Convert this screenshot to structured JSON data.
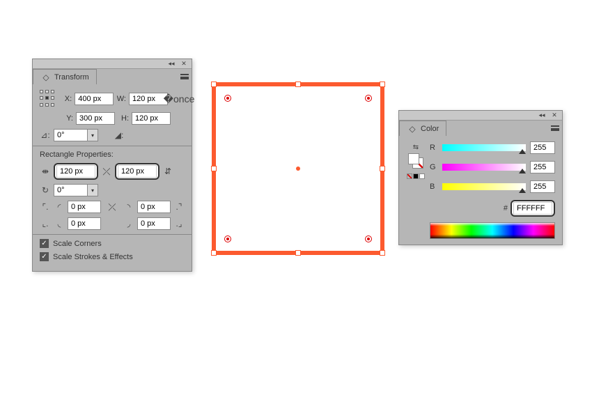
{
  "transform": {
    "title": "Transform",
    "x_label": "X:",
    "x": "400 px",
    "y_label": "Y:",
    "y": "300 px",
    "w_label": "W:",
    "w": "120 px",
    "h_label": "H:",
    "h": "120 px",
    "rotate": "0°",
    "section_label": "Rectangle Properties:",
    "rect_w": "120 px",
    "rect_h": "120 px",
    "rect_rotate": "0°",
    "corner_tl": "0 px",
    "corner_tr": "0 px",
    "corner_bl": "0 px",
    "corner_br": "0 px",
    "scale_corners": "Scale Corners",
    "scale_strokes": "Scale Strokes & Effects"
  },
  "color": {
    "title": "Color",
    "r_label": "R",
    "r": "255",
    "g_label": "G",
    "g": "255",
    "b_label": "B",
    "b": "255",
    "hash": "#",
    "hex": "FFFFFF"
  }
}
